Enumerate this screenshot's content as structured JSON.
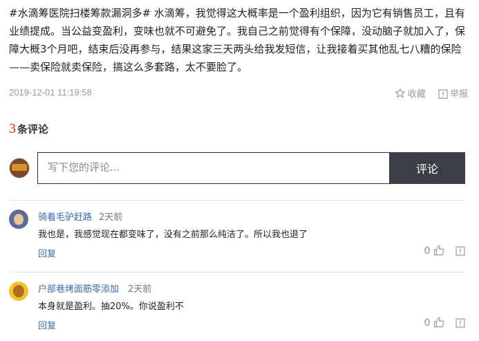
{
  "post": {
    "text": "#水滴筹医院扫楼筹款漏洞多# 水滴筹，我觉得这大概率是一个盈利组织，因为它有销售员工，且有业绩提成。当公益变盈利，变味也就不可避免了。我自己之前觉得有个保障，没动脑子就加入了，保障大概3个月吧，结束后没再参与，结果这家三天两头给我发短信，让我接着买其他乱七八糟的保险——卖保险就卖保险，搞这么多套路，太不要脸了。",
    "time": "2019-12-01 11:19:58",
    "favorite_label": "收藏",
    "report_label": "举报"
  },
  "comments_header": {
    "count": "3",
    "label": "条评论"
  },
  "comment_input": {
    "placeholder": "写下您的评论...",
    "submit_label": "评论"
  },
  "comments": [
    {
      "user": "骑着毛驴赶路",
      "ago": "2天前",
      "text": "我也是，我感觉现在都变味了，没有之前那么纯洁了。所以我也退了",
      "reply_label": "回复",
      "likes": "0"
    },
    {
      "user": "户部巷烤面筋零添加",
      "ago": "2天前",
      "text": "本身就是盈利。抽20%。你说盈利不",
      "reply_label": "回复",
      "likes": "0"
    }
  ],
  "colors": {
    "accent": "#e2231a",
    "link": "#3a6aa8",
    "button": "#3b3e45"
  },
  "icons": [
    "star-icon",
    "report-icon",
    "thumbs-up-icon",
    "flag-icon"
  ]
}
